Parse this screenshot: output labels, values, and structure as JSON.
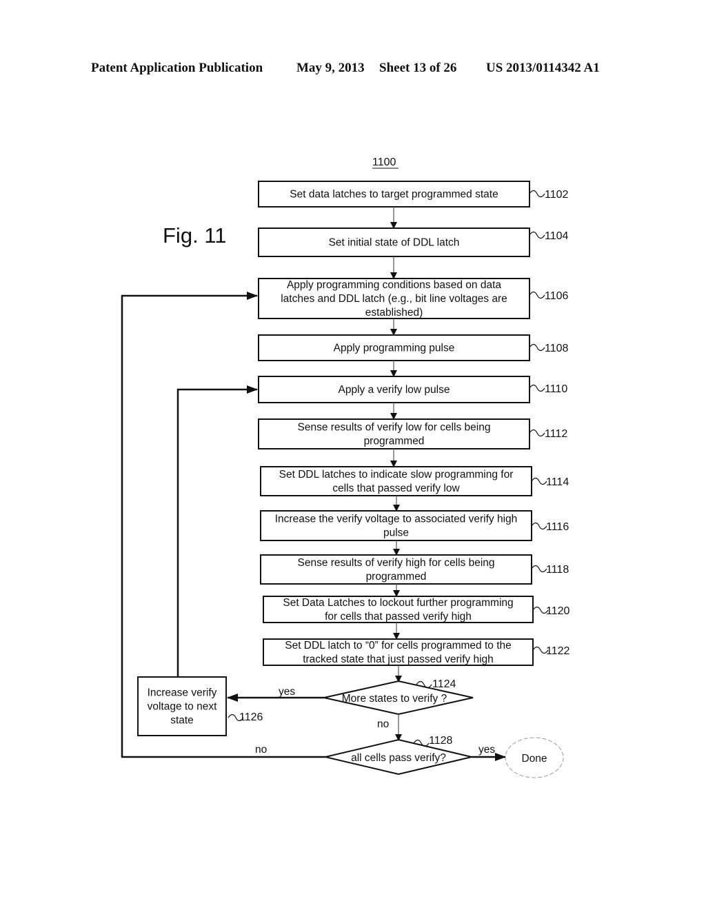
{
  "header": {
    "publication": "Patent Application Publication",
    "date": "May 9, 2013",
    "sheet": "Sheet 13 of 26",
    "number": "US 2013/0114342 A1"
  },
  "figure": {
    "label": "Fig. 11",
    "ref": "1100"
  },
  "steps": [
    {
      "ref": "1102",
      "lines": [
        "Set data latches to target programmed state"
      ]
    },
    {
      "ref": "1104",
      "lines": [
        "Set initial state of DDL latch"
      ]
    },
    {
      "ref": "1106",
      "lines": [
        "Apply programming conditions based on data",
        "latches and DDL latch (e.g., bit line voltages are",
        "established)"
      ]
    },
    {
      "ref": "1108",
      "lines": [
        "Apply programming pulse"
      ]
    },
    {
      "ref": "1110",
      "lines": [
        "Apply a verify low pulse"
      ]
    },
    {
      "ref": "1112",
      "lines": [
        "Sense results of verify low for cells being",
        "programmed"
      ]
    },
    {
      "ref": "1114",
      "lines": [
        "Set DDL latches to indicate slow programming for",
        "cells that passed verify low"
      ]
    },
    {
      "ref": "1116",
      "lines": [
        "Increase the verify voltage to associated verify high",
        "pulse"
      ]
    },
    {
      "ref": "1118",
      "lines": [
        "Sense results of verify high for cells being",
        "programmed"
      ]
    },
    {
      "ref": "1120",
      "lines": [
        "Set Data Latches to lockout further programming",
        "for cells that passed verify high"
      ]
    },
    {
      "ref": "1122",
      "lines": [
        "Set DDL latch to “0” for cells programmed to the",
        "tracked state that just passed verify high"
      ]
    }
  ],
  "side_box": {
    "ref": "1126",
    "lines": [
      "Increase verify",
      "voltage to next",
      "state"
    ]
  },
  "decisions": [
    {
      "ref": "1124",
      "text": "More states to verify ?",
      "yes_label": "yes",
      "no_label": "no"
    },
    {
      "ref": "1128",
      "text": "all cells pass verify?",
      "yes_label": "yes",
      "no_label": "no"
    }
  ],
  "terminal": {
    "text": "Done"
  }
}
